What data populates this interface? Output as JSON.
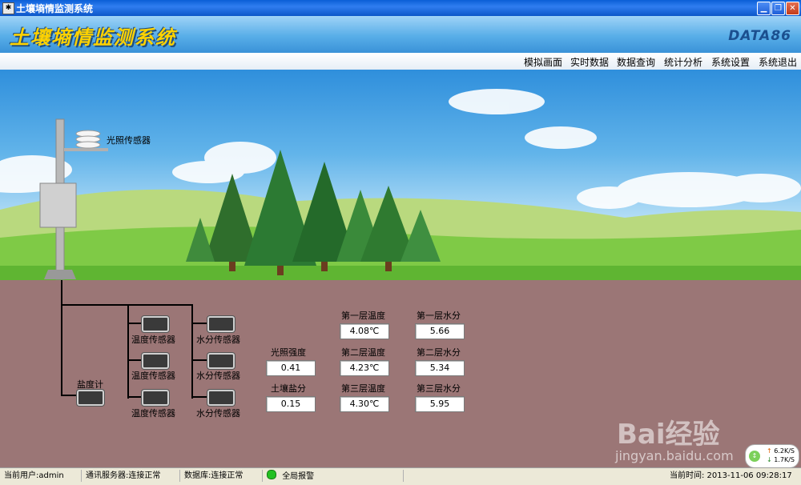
{
  "window": {
    "title": "土壤墒情监测系统"
  },
  "header": {
    "app_title": "土壤墒情监测系统",
    "brand": "DATA86"
  },
  "menu": [
    "模拟画面",
    "实时数据",
    "数据查询",
    "统计分析",
    "系统设置",
    "系统退出"
  ],
  "scene": {
    "light_sensor_label": "光照传感器",
    "salinity_meter_label": "盐度计",
    "temp_sensor_label": "温度传感器",
    "moisture_sensor_label": "水分传感器"
  },
  "readings": {
    "light": {
      "label": "光照强度",
      "value": "0.41"
    },
    "salinity": {
      "label": "土壤盐分",
      "value": "0.15"
    },
    "temp": [
      {
        "label": "第一层温度",
        "value": "4.08℃"
      },
      {
        "label": "第二层温度",
        "value": "4.23℃"
      },
      {
        "label": "第三层温度",
        "value": "4.30℃"
      }
    ],
    "moisture": [
      {
        "label": "第一层水分",
        "value": "5.66"
      },
      {
        "label": "第二层水分",
        "value": "5.34"
      },
      {
        "label": "第三层水分",
        "value": "5.95"
      }
    ]
  },
  "network_badge": {
    "up": "6.2K/S",
    "down": "1.7K/S"
  },
  "watermark": {
    "logo": "Bai经验",
    "url": "jingyan.baidu.com"
  },
  "status": {
    "user": "当前用户:admin",
    "comm_server": "通讯服务器:连接正常",
    "database": "数据库:连接正常",
    "alarm": "全局报警",
    "time": "当前时间: 2013-11-06 09:28:17"
  },
  "colors": {
    "soil": "#9b7676",
    "grass": "#6cc23a",
    "alarm_ok": "#22c022",
    "title_yellow": "#ffd200"
  }
}
